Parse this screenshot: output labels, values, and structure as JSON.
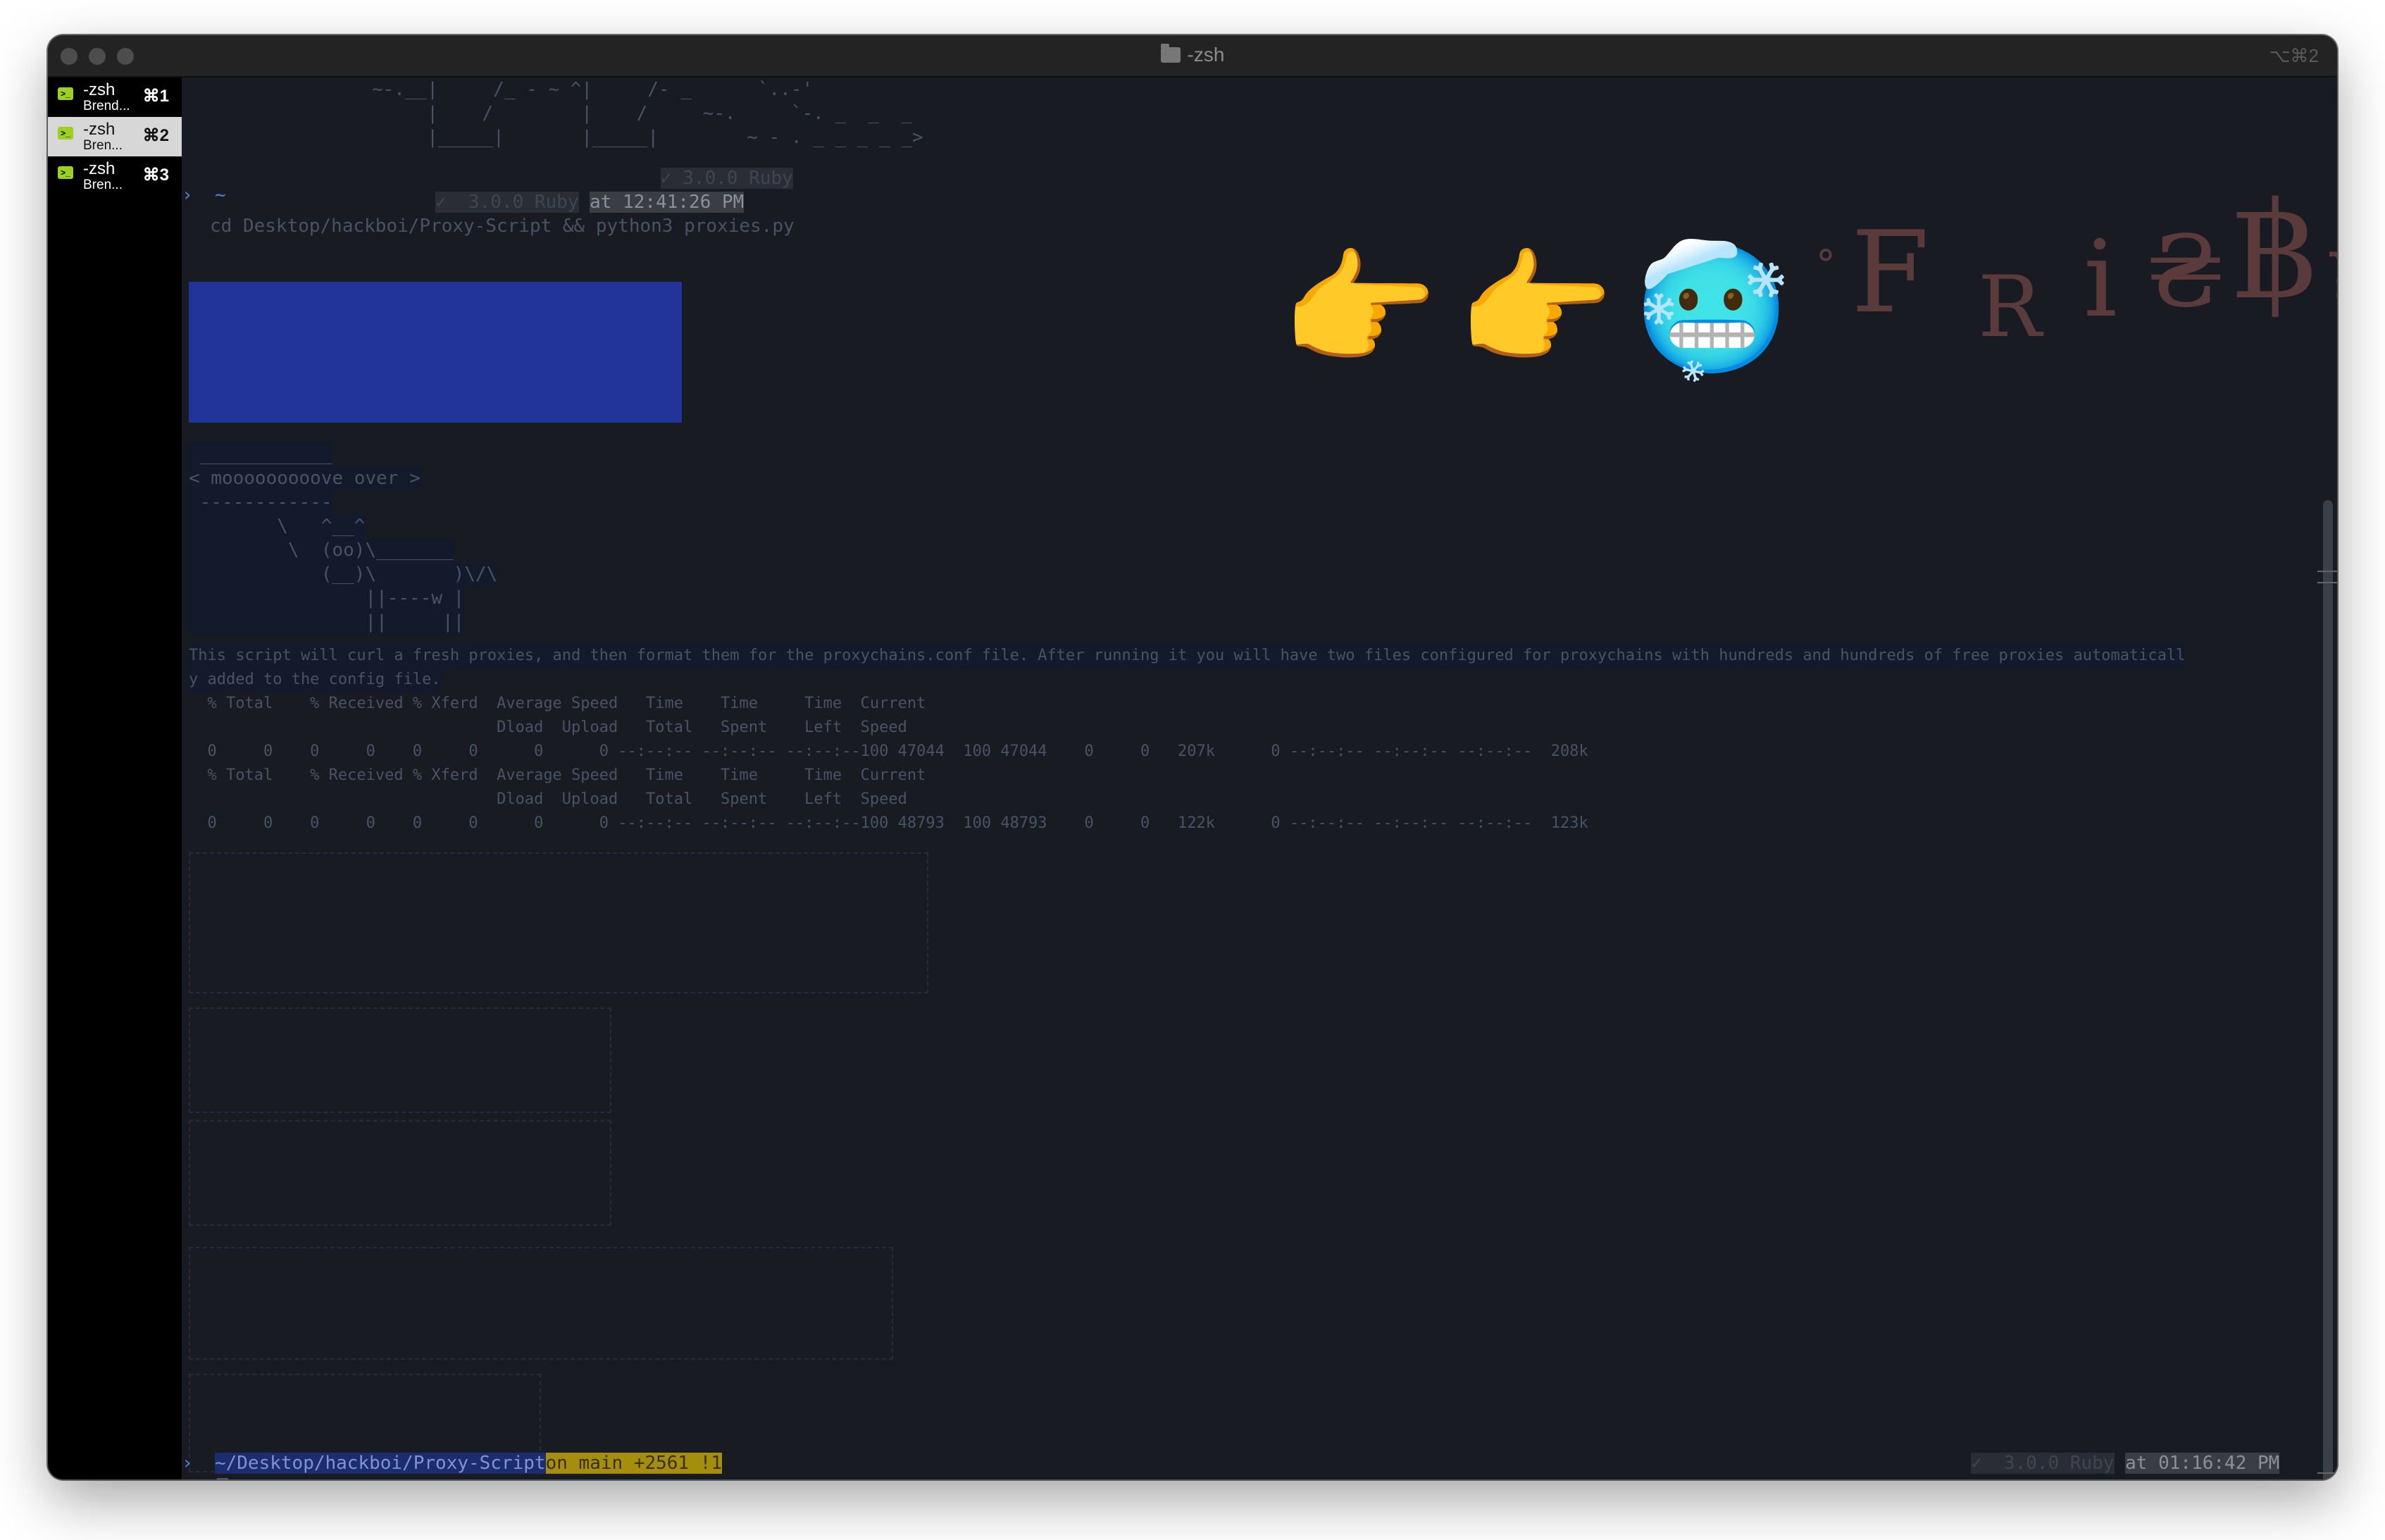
{
  "window": {
    "title": "-zsh",
    "shortcut_hint": "⌥⌘2"
  },
  "sidebar": {
    "tabs": [
      {
        "name": "-zsh",
        "sub": "Brend...",
        "key": "⌘1"
      },
      {
        "name": "-zsh",
        "sub": "Bren...",
        "key": "⌘2"
      },
      {
        "name": "-zsh",
        "sub": "Bren...",
        "key": "⌘3"
      }
    ]
  },
  "terminal": {
    "ascii_top": [
      "~-.__|     /_ - ~ ^|     /- _      `..-'",
      "     |    /        |    /     ~-.     `-. _  _  _",
      "     |_____|       |_____|        ~ - . _ _ _ _ _>"
    ],
    "prompt1": {
      "dir": "~",
      "ruby": "✓  3.0.0 Ruby",
      "time": "at 12:41:26 PM",
      "status": "✓ 3.0.0 Ruby"
    },
    "command": "cd Desktop/hackboi/Proxy-Script && python3 proxies.py",
    "cowsay": [
      " ____________",
      "< mooooooooove over >",
      " ------------",
      "        \\   ^__^",
      "         \\  (oo)\\_______",
      "            (__)\\       )\\/\\",
      "                ||----w |",
      "                ||     ||"
    ],
    "info": "This script will curl a fresh proxies, and then format them for the proxychains.conf file. After running it you will have two files configured for proxychains with hundreds and hundreds of free proxies automaticall",
    "info2": "y added to the config file.",
    "curl_header1": "  % Total    % Received % Xferd  Average Speed   Time    Time     Time  Current",
    "curl_header2": "                                 Dload  Upload   Total   Spent    Left  Speed",
    "curl_row1": "  0     0    0     0    0     0      0      0 --:--:-- --:--:-- --:--:--100 47044  100 47044    0     0   207k      0 --:--:-- --:--:-- --:--:--  208k",
    "curl_row2": "  0     0    0     0    0     0      0      0 --:--:-- --:--:-- --:--:--100 48793  100 48793    0     0   122k      0 --:--:-- --:--:-- --:--:--  123k",
    "prompt2": {
      "path": "~/Desktop/hackboi/Proxy-Script",
      "git": "on main +2561 !1",
      "ruby": "✓  3.0.0 Ruby",
      "time": "at 01:16:42 PM"
    },
    "banner": {
      "emoji1": "👉",
      "emoji2": "👉",
      "emoji3": "🥶",
      "text_chars": [
        "°",
        "F",
        "R",
        "i",
        "₴",
        "฿",
        "¥"
      ]
    }
  }
}
